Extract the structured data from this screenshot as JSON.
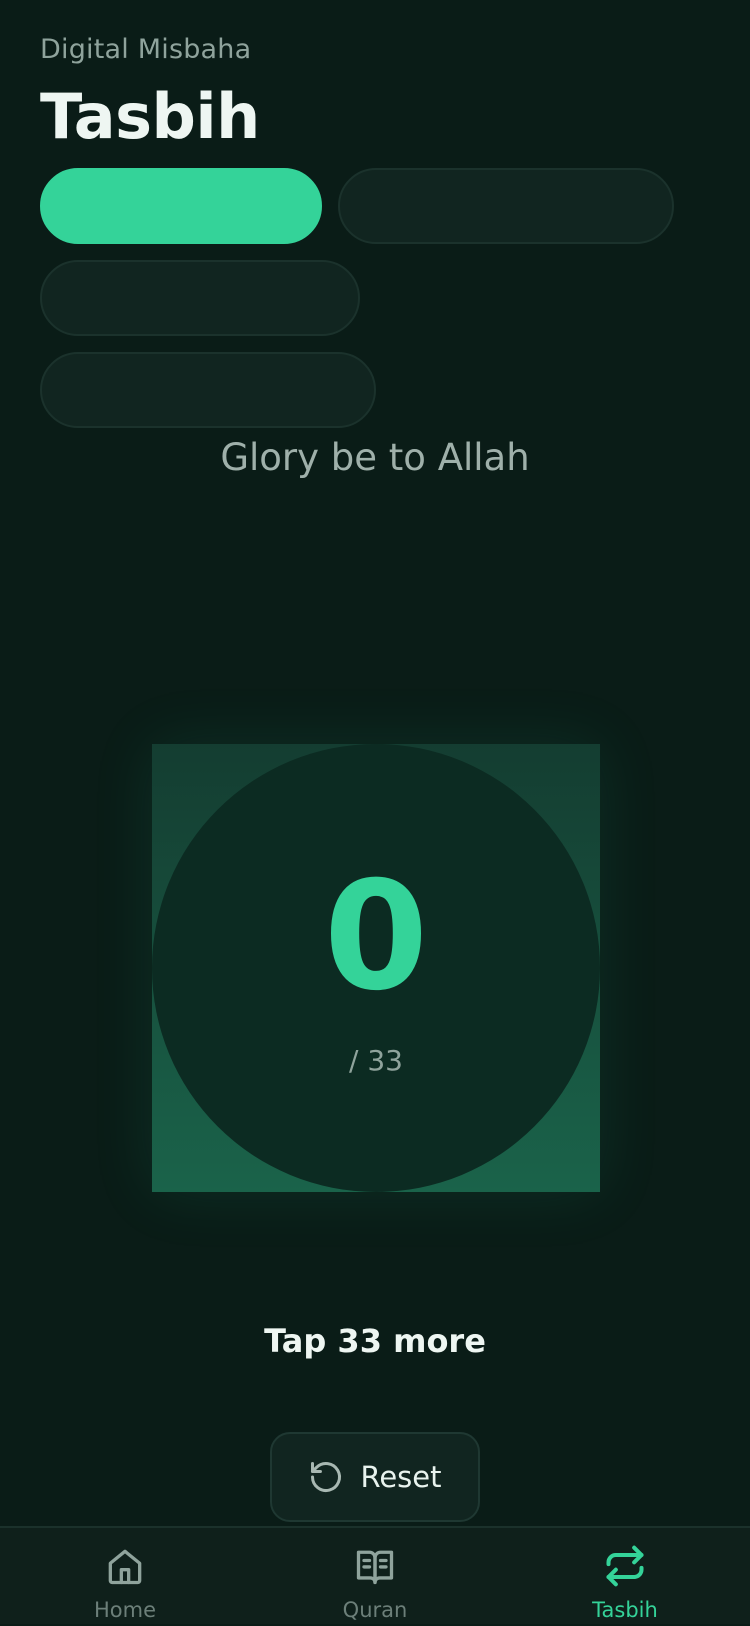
{
  "header": {
    "subtitle": "Digital Misbaha",
    "title": "Tasbih"
  },
  "dhikr_options": {
    "active_index": 0
  },
  "dhikr": {
    "translation": "Glory be to Allah"
  },
  "counter": {
    "count": "0",
    "target_text": "/ 33",
    "progress": 0
  },
  "hint": "Tap 33 more",
  "reset": {
    "label": "Reset",
    "icon": "rotate-ccw-icon"
  },
  "nav": {
    "items": [
      {
        "label": "Home",
        "icon": "home-icon",
        "active": false
      },
      {
        "label": "Quran",
        "icon": "book-open-icon",
        "active": false
      },
      {
        "label": "Tasbih",
        "icon": "repeat-icon",
        "active": true
      }
    ]
  },
  "colors": {
    "background": "#0a1c17",
    "accent": "#34d399",
    "surface": "#112520",
    "muted_text": "#8fa39c"
  }
}
